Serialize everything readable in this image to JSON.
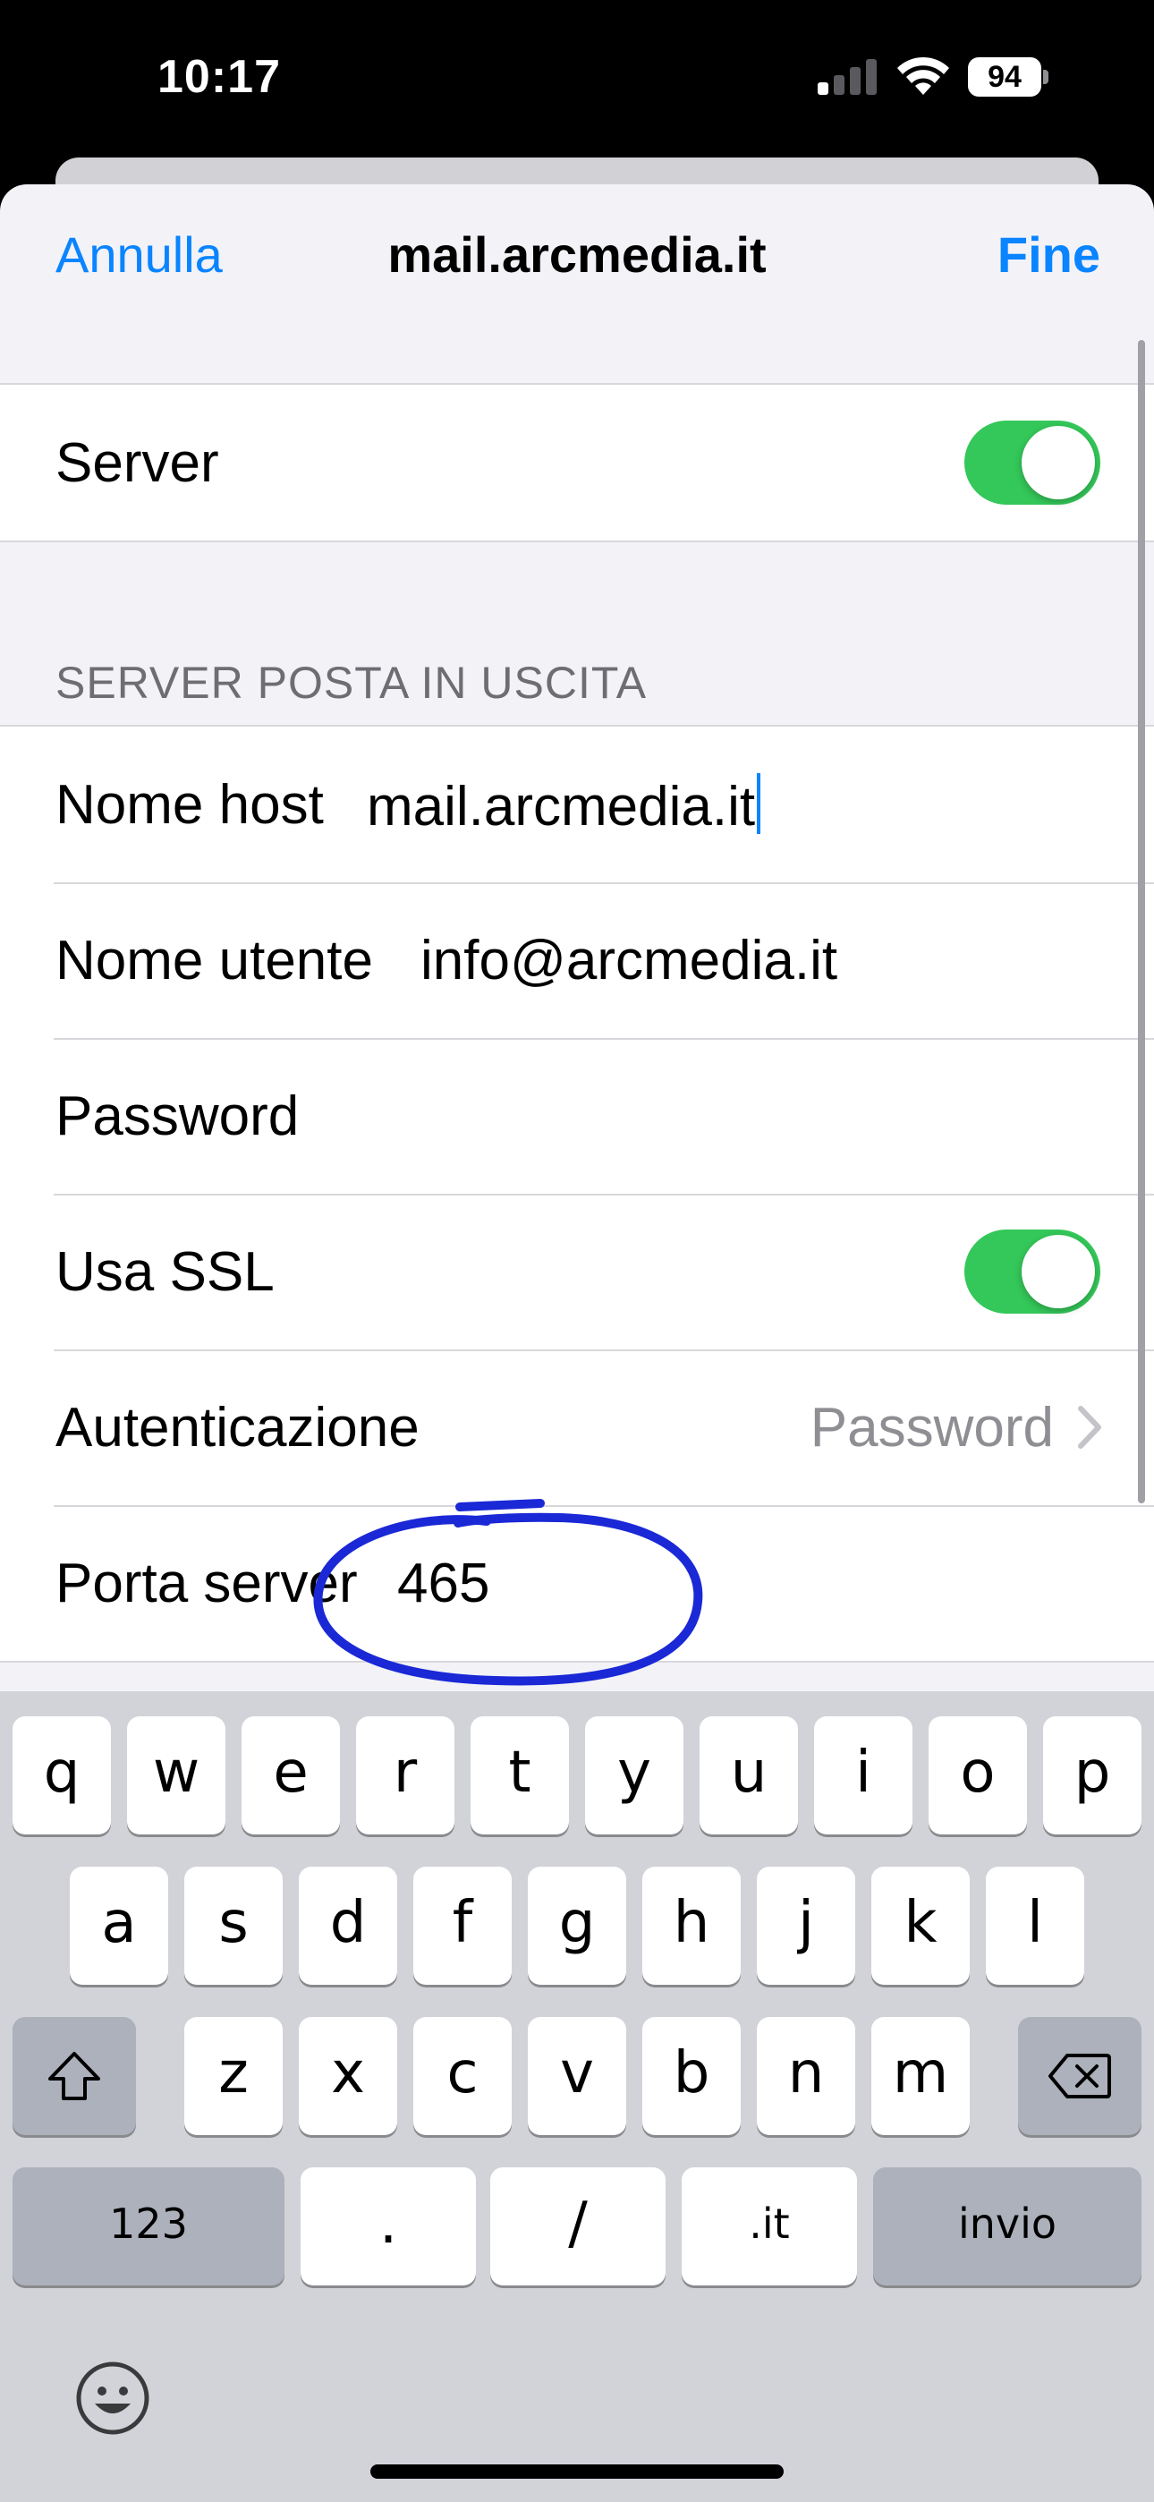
{
  "status_bar": {
    "time": "10:17",
    "battery": "94"
  },
  "nav": {
    "cancel": "Annulla",
    "title": "mail.arcmedia.it",
    "done": "Fine"
  },
  "server_row": {
    "label": "Server",
    "enabled": true
  },
  "section": {
    "header": "SERVER POSTA IN USCITA"
  },
  "rows": {
    "hostname": {
      "label": "Nome host",
      "value": "mail.arcmedia.it"
    },
    "username": {
      "label": "Nome utente",
      "value": "info@arcmedia.it"
    },
    "password": {
      "label": "Password"
    },
    "ssl": {
      "label": "Usa SSL",
      "enabled": true
    },
    "auth": {
      "label": "Autenticazione",
      "value": "Password"
    },
    "port": {
      "label": "Porta server",
      "value": "465"
    }
  },
  "colors": {
    "accent": "#0a84ff",
    "toggle_on": "#34c759",
    "annotation": "#1a28d6"
  },
  "keyboard": {
    "row1": [
      "q",
      "w",
      "e",
      "r",
      "t",
      "y",
      "u",
      "i",
      "o",
      "p"
    ],
    "row2": [
      "a",
      "s",
      "d",
      "f",
      "g",
      "h",
      "j",
      "k",
      "l"
    ],
    "row3": [
      "z",
      "x",
      "c",
      "v",
      "b",
      "n",
      "m"
    ],
    "numbers": "123",
    "dot": ".",
    "slash": "/",
    "domain": ".it",
    "return": "invio"
  }
}
